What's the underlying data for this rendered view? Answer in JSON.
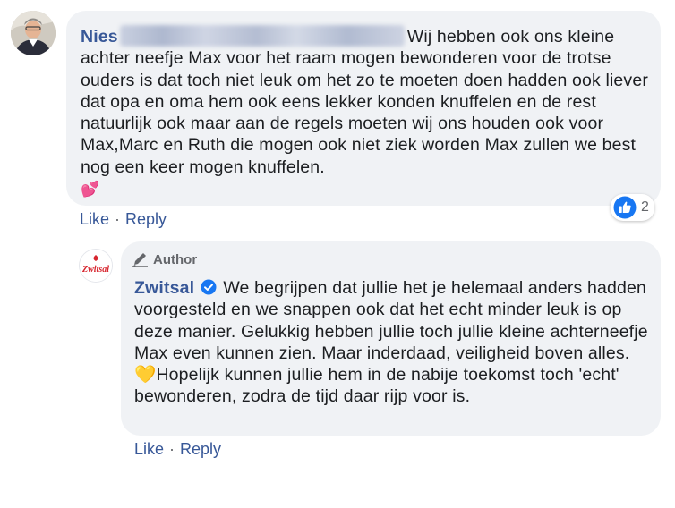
{
  "comment": {
    "author_first": "Nies",
    "text_main": "Wij hebben ook ons kleine achter neefje Max voor het raam mogen bewonderen voor de trotse ouders is dat toch niet leuk om het zo te moeten doen hadden ook liever dat opa en oma hem ook eens lekker konden knuffelen en de rest natuurlijk ook maar aan de regels moeten wij ons houden ook voor Max,Marc en Ruth die mogen ook niet ziek worden Max zullen we best nog een keer mogen knuffelen.",
    "emoji": "💕",
    "actions": {
      "like": "Like",
      "separator": "·",
      "reply": "Reply"
    },
    "reaction": {
      "icon": "like-reaction-icon",
      "count": "2"
    }
  },
  "reply": {
    "badge": "Author",
    "author": "Zwitsal",
    "avatar_logo_text": "Zwitsal",
    "text_part1": "We begrijpen dat jullie het je helemaal anders hadden voorgesteld en we snappen ook dat het echt minder leuk is op deze manier. Gelukkig hebben jullie toch jullie kleine achterneefje Max even kunnen zien. Maar inderdaad, veiligheid boven alles.",
    "emoji": "💛",
    "text_part2": "Hopelijk kunnen jullie hem in de nabije toekomst toch 'echt' bewonderen, zodra de tijd daar rijp voor is.",
    "actions": {
      "like": "Like",
      "separator": "·",
      "reply": "Reply"
    }
  },
  "colors": {
    "name": "#385898",
    "bubble": "#f0f2f5",
    "verified": "#1877f2",
    "brand_red": "#d7262f"
  }
}
